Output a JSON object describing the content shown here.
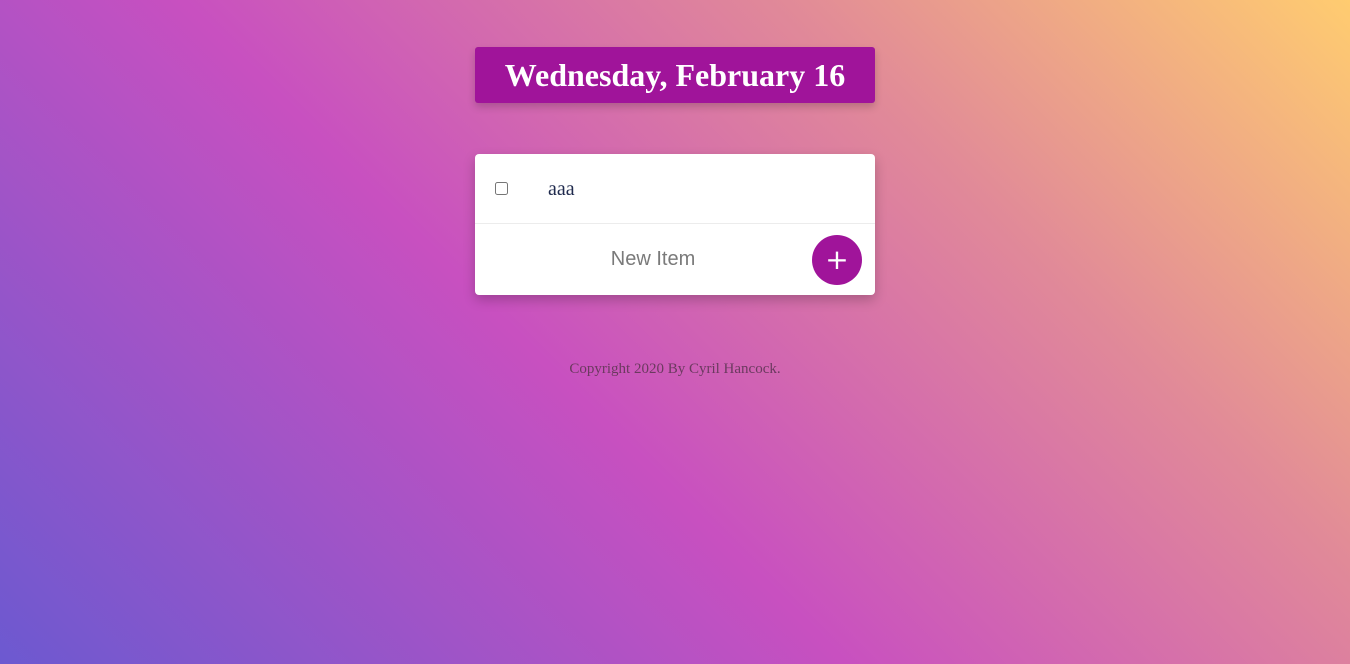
{
  "header": {
    "date_title": "Wednesday, February 16"
  },
  "todo": {
    "items": [
      {
        "label": "aaa",
        "checked": false
      }
    ],
    "new_item_placeholder": "New Item",
    "add_button_label": "+"
  },
  "footer": {
    "copyright": "Copyright 2020 By Cyril Hancock."
  },
  "colors": {
    "accent": "#a0149a",
    "card_bg": "#ffffff",
    "gradient_start": "#6c59d0",
    "gradient_mid": "#c850c0",
    "gradient_end": "#ffcc70"
  }
}
